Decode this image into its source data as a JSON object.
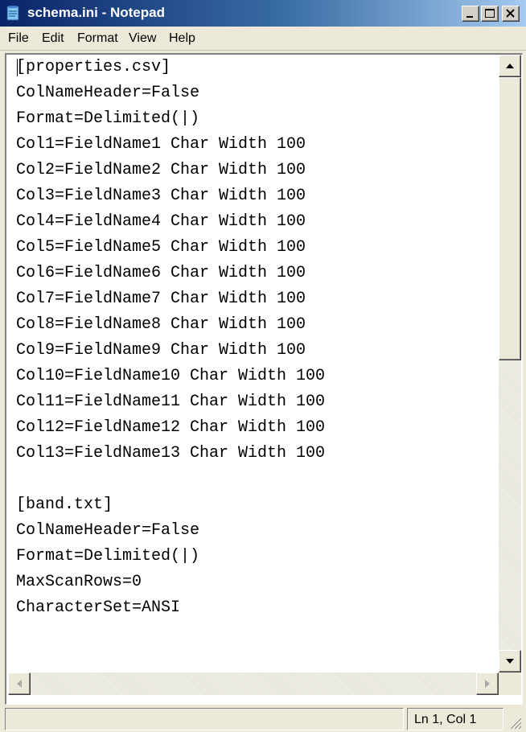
{
  "window": {
    "title": "schema.ini - Notepad",
    "icon": "notepad-icon",
    "controls": {
      "minimize_icon": "minimize-icon",
      "maximize_icon": "maximize-icon",
      "close_icon": "close-icon"
    }
  },
  "menu": {
    "items": [
      "File",
      "Edit",
      "Format",
      "View",
      "Help"
    ]
  },
  "editor": {
    "lines": [
      "[properties.csv]",
      "ColNameHeader=False",
      "Format=Delimited(|)",
      "Col1=FieldName1 Char Width 100",
      "Col2=FieldName2 Char Width 100",
      "Col3=FieldName3 Char Width 100",
      "Col4=FieldName4 Char Width 100",
      "Col5=FieldName5 Char Width 100",
      "Col6=FieldName6 Char Width 100",
      "Col7=FieldName7 Char Width 100",
      "Col8=FieldName8 Char Width 100",
      "Col9=FieldName9 Char Width 100",
      "Col10=FieldName10 Char Width 100",
      "Col11=FieldName11 Char Width 100",
      "Col12=FieldName12 Char Width 100",
      "Col13=FieldName13 Char Width 100",
      "",
      "[band.txt]",
      "ColNameHeader=False",
      "Format=Delimited(|)",
      "MaxScanRows=0",
      "CharacterSet=ANSI",
      ""
    ]
  },
  "statusbar": {
    "message": "",
    "position": "Ln 1, Col 1"
  },
  "colors": {
    "titlebar_start": "#0a246a",
    "titlebar_end": "#a6caf0",
    "face": "#ece9d8"
  }
}
